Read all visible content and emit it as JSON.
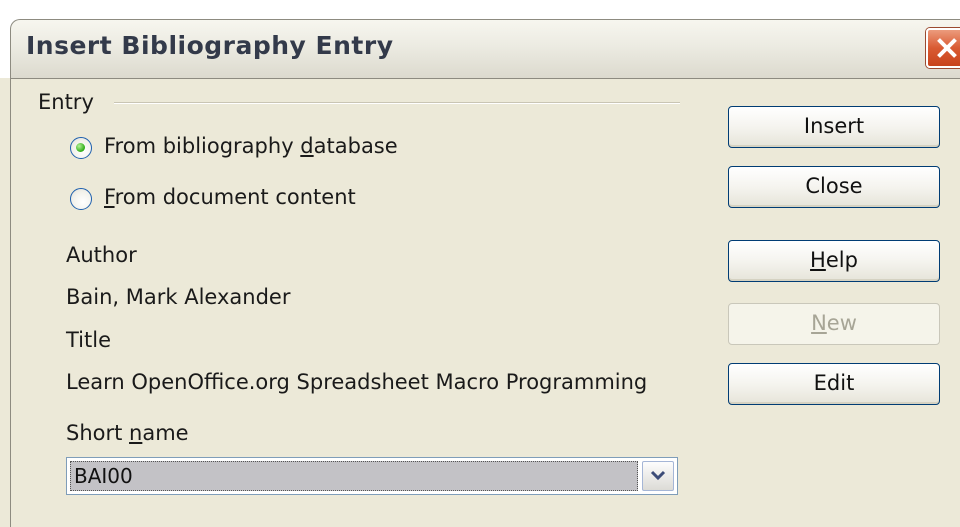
{
  "window": {
    "title": "Insert Bibliography Entry",
    "close_icon": "close-icon"
  },
  "entry_group": {
    "label": "Entry",
    "radios": [
      {
        "pre": "From bibliography ",
        "accel": "d",
        "post": "atabase",
        "checked": true
      },
      {
        "pre": "",
        "accel": "F",
        "post": "rom document content",
        "checked": false
      }
    ]
  },
  "fields": {
    "author_label": "Author",
    "author_value": "Bain, Mark Alexander",
    "title_label": "Title",
    "title_value": "Learn OpenOffice.org Spreadsheet Macro Programming",
    "short_name_label_pre": "Short ",
    "short_name_label_accel": "n",
    "short_name_label_post": "ame",
    "short_name_value": "BAI00"
  },
  "buttons": {
    "insert": "Insert",
    "close": "Close",
    "help_accel": "H",
    "help_rest": "elp",
    "new_accel": "N",
    "new_rest": "ew",
    "new_disabled": true,
    "edit": "Edit"
  },
  "colors": {
    "dialog_bg": "#ece9d8",
    "radio_checked": "#35b21c",
    "close_button": "#d95b33",
    "button_border": "#003c74"
  }
}
